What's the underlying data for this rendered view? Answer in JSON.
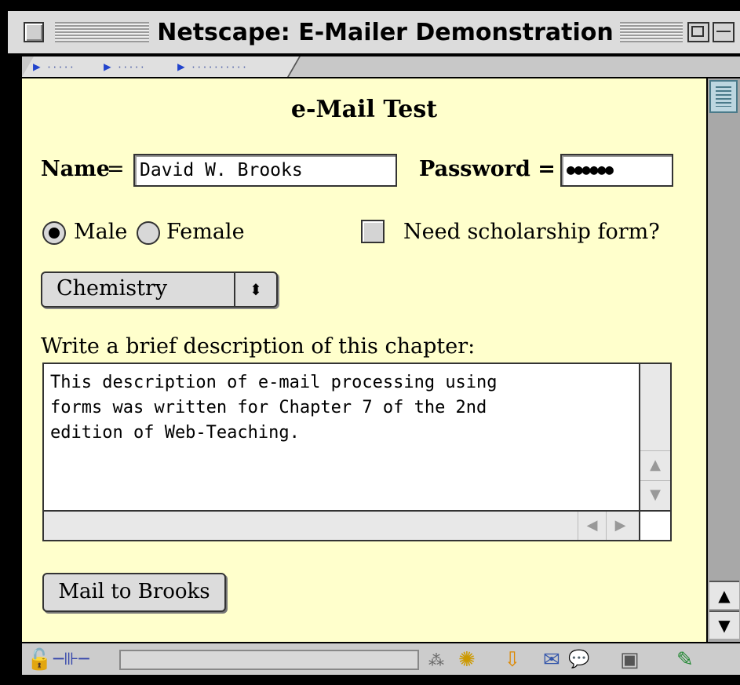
{
  "window": {
    "title": "Netscape: E-Mailer Demonstration"
  },
  "tabbar": {
    "tabs": [
      {
        "label": "·····"
      },
      {
        "label": "·····"
      },
      {
        "label": "··········"
      }
    ]
  },
  "form": {
    "heading": "e-Mail Test",
    "name_label": "Name",
    "name_eq": "=",
    "name_value": "David W. Brooks",
    "password_label": "Password =",
    "password_value": "●●●●●●",
    "gender_options": [
      "Male",
      "Female"
    ],
    "gender_selected": "Male",
    "scholarship_label": "Need scholarship form?",
    "scholarship_checked": false,
    "subject_selected": "Chemistry",
    "popup_arrows": "⬍",
    "description_label": "Write a brief description of this chapter:",
    "description_value": "This description of e-mail processing using\nforms was written for Chapter 7 of the 2nd\nedition of Web-Teaching.",
    "submit_label": "Mail to Brooks"
  },
  "scroll": {
    "up_arrow": "▲",
    "down_arrow": "▼",
    "left_arrow": "◀",
    "right_arrow": "▶"
  },
  "statusbar": {
    "lock_icon": "🔓",
    "connect_icon": "─⊪─",
    "icons": [
      "⁂",
      "✺",
      "⇩",
      "✉",
      "💬",
      "▣",
      "✎"
    ]
  }
}
